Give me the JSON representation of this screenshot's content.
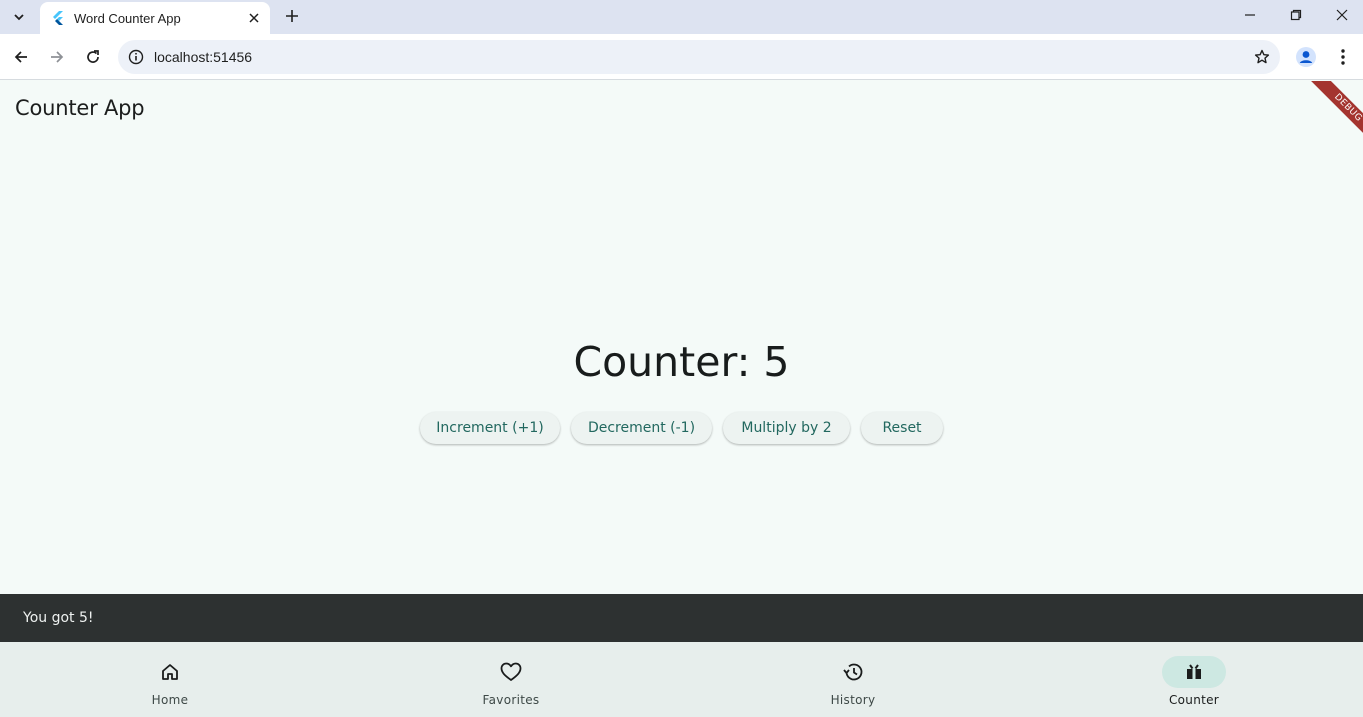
{
  "browser": {
    "tab_title": "Word Counter App",
    "url": "localhost:51456"
  },
  "app": {
    "title": "Counter App",
    "debug_banner": "DEBUG",
    "counter_text": "Counter: 5",
    "counter_value": 5,
    "buttons": {
      "increment": "Increment (+1)",
      "decrement": "Decrement (-1)",
      "multiply": "Multiply by 2",
      "reset": "Reset"
    },
    "snackbar": "You got 5!",
    "nav": [
      {
        "label": "Home",
        "icon": "home-icon",
        "active": false
      },
      {
        "label": "Favorites",
        "icon": "heart-icon",
        "active": false
      },
      {
        "label": "History",
        "icon": "history-icon",
        "active": false
      },
      {
        "label": "Counter",
        "icon": "counter-icon",
        "active": true
      }
    ]
  },
  "colors": {
    "accent": "#22685f",
    "nav_indicator": "#cde8e2",
    "snackbar_bg": "#2d3131",
    "debug_ribbon": "#a4342f"
  }
}
